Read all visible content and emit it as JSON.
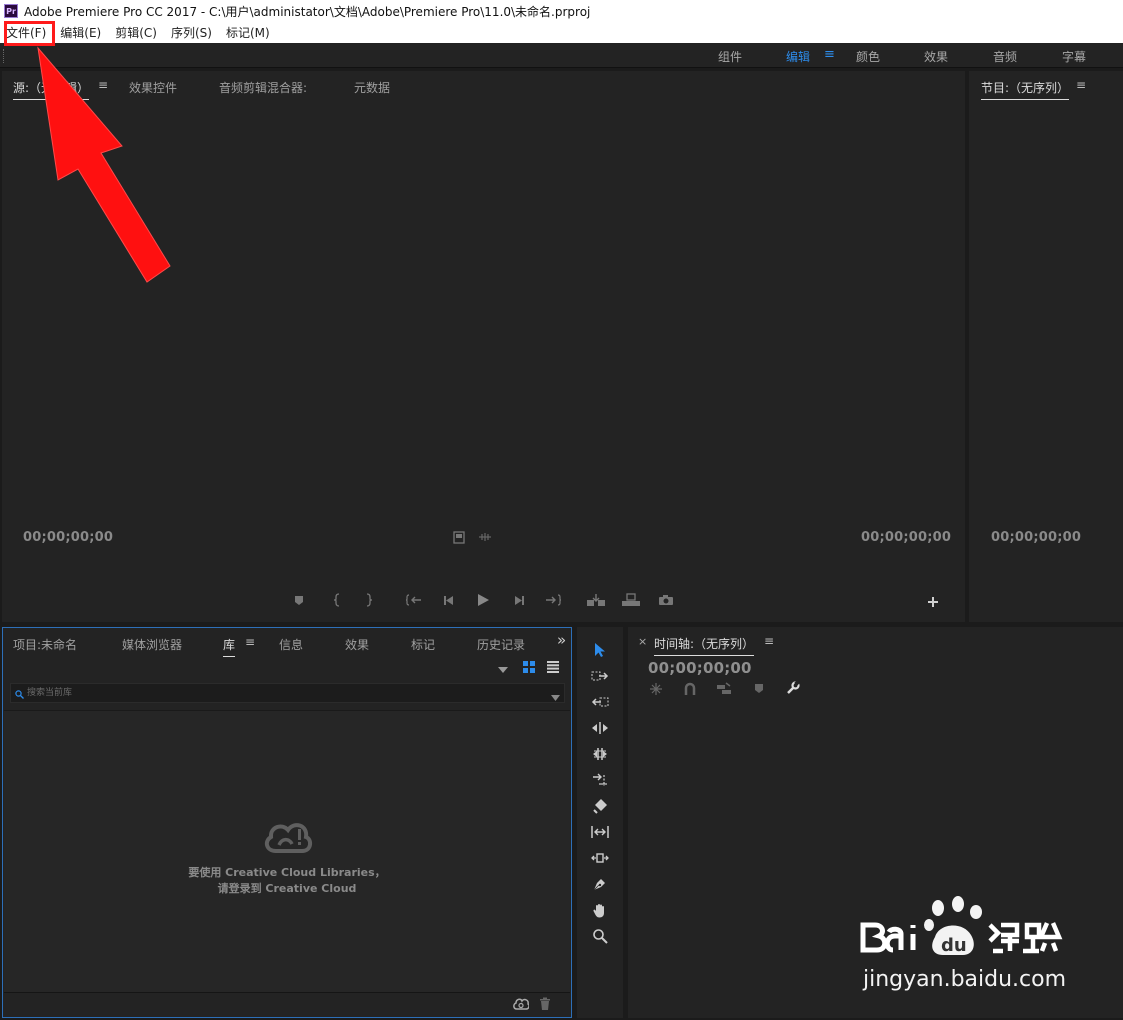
{
  "window": {
    "app_icon_text": "Pr",
    "title": "Adobe Premiere Pro CC 2017 - C:\\用户\\administator\\文档\\Adobe\\Premiere Pro\\11.0\\未命名.prproj"
  },
  "menu": {
    "items": [
      {
        "label": "文件(F)"
      },
      {
        "label": "编辑(E)"
      },
      {
        "label": "剪辑(C)"
      },
      {
        "label": "序列(S)"
      },
      {
        "label": "标记(M)"
      }
    ]
  },
  "workspaces": {
    "tabs": [
      {
        "label": "组件"
      },
      {
        "label": "编辑"
      },
      {
        "label": "颜色"
      },
      {
        "label": "效果"
      },
      {
        "label": "音频"
      },
      {
        "label": "字幕"
      }
    ],
    "active": "编辑"
  },
  "source_panel": {
    "tabs": [
      {
        "label": "源:（无剪辑）"
      },
      {
        "label": "效果控件"
      },
      {
        "label": "音频剪辑混合器:"
      },
      {
        "label": "元数据"
      }
    ],
    "timecode_left": "00;00;00;00",
    "timecode_right": "00;00;00;00"
  },
  "program_panel": {
    "tab": "节目:（无序列）",
    "timecode": "00;00;00;00"
  },
  "project_panel": {
    "tabs": [
      {
        "label": "项目:未命名"
      },
      {
        "label": "媒体浏览器"
      },
      {
        "label": "库"
      },
      {
        "label": "信息"
      },
      {
        "label": "效果"
      },
      {
        "label": "标记"
      },
      {
        "label": "历史记录"
      }
    ],
    "overflow": "»",
    "search_placeholder": "搜索当前库",
    "message_line1": "要使用 Creative Cloud Libraries，",
    "message_line2": "请登录到 Creative Cloud"
  },
  "timeline_panel": {
    "close": "×",
    "tab": "时间轴:（无序列）",
    "timecode": "00;00;00;00"
  },
  "menu_glyph": "≡",
  "colors": {
    "accent": "#2d8ceb",
    "annotation": "#ff1a1a",
    "panel_bg": "#232323"
  },
  "watermark": {
    "line2": "jingyan.baidu.com"
  }
}
